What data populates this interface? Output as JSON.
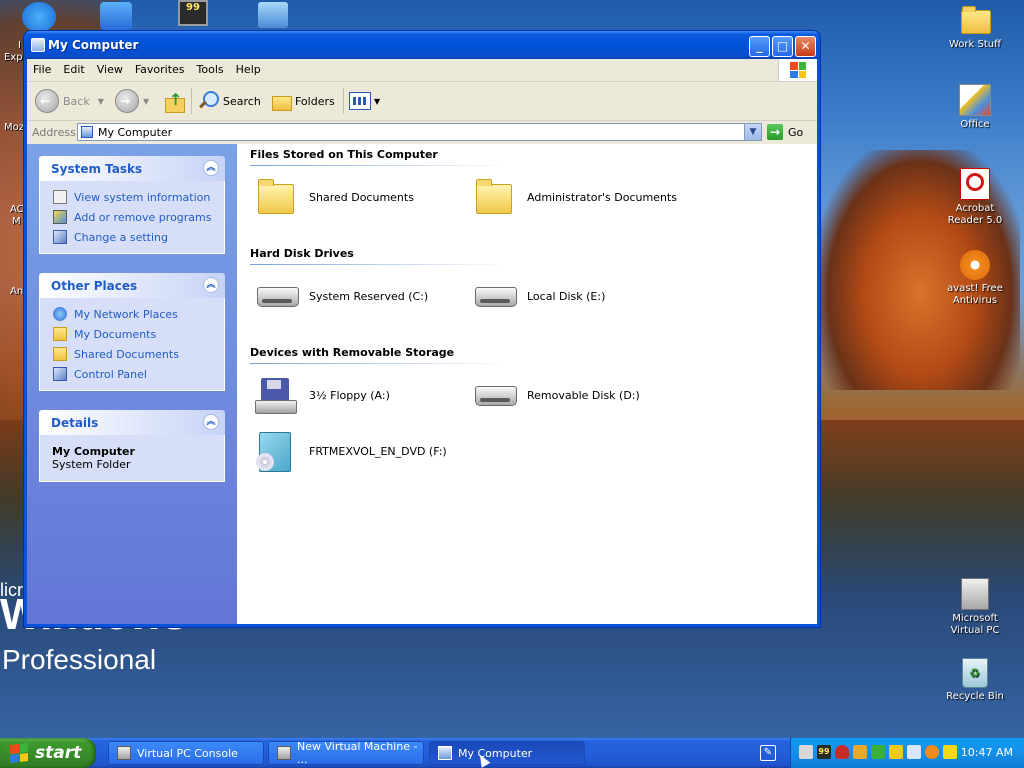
{
  "desktop": {
    "left_labels": [
      "I",
      "Exp",
      "Moz",
      "AC",
      "M",
      "An"
    ],
    "top_badge": "99",
    "icons": [
      {
        "label": "Work Stuff"
      },
      {
        "label": "Office"
      },
      {
        "label": "Acrobat Reader 5.0"
      },
      {
        "label": "avast! Free Antivirus"
      },
      {
        "label": "Microsoft Virtual PC"
      },
      {
        "label": "Recycle Bin"
      }
    ],
    "brand": {
      "line1": "licr",
      "line2": "Windows",
      "line3": "Professional"
    }
  },
  "window": {
    "title": "My Computer",
    "controls": {
      "minimize": "_",
      "maximize": "□",
      "close": "✕"
    },
    "menu": [
      "File",
      "Edit",
      "View",
      "Favorites",
      "Tools",
      "Help"
    ],
    "toolbar": {
      "back": "Back",
      "search": "Search",
      "folders": "Folders"
    },
    "address": {
      "label": "Address",
      "value": "My Computer",
      "go": "Go"
    },
    "left_pane": {
      "system_tasks": {
        "title": "System Tasks",
        "items": [
          "View system information",
          "Add or remove programs",
          "Change a setting"
        ]
      },
      "other_places": {
        "title": "Other Places",
        "items": [
          "My Network Places",
          "My Documents",
          "Shared Documents",
          "Control Panel"
        ]
      },
      "details": {
        "title": "Details",
        "name": "My Computer",
        "type": "System Folder"
      }
    },
    "groups": {
      "files": {
        "title": "Files Stored on This Computer",
        "items": [
          "Shared Documents",
          "Administrator's Documents"
        ]
      },
      "hdd": {
        "title": "Hard Disk Drives",
        "items": [
          "System Reserved (C:)",
          "Local Disk (E:)"
        ]
      },
      "removable": {
        "title": "Devices with Removable Storage",
        "items": [
          "3½ Floppy (A:)",
          "Removable Disk (D:)",
          "FRTMEXVOL_EN_DVD (F:)"
        ]
      }
    }
  },
  "taskbar": {
    "start": "start",
    "tasks": [
      "Virtual PC Console",
      "New Virtual Machine - ...",
      "My Computer"
    ],
    "tray_badge": "99",
    "clock": "10:47 AM"
  },
  "colors": {
    "accent": "#0a52d8",
    "start_green": "#3c9a2c",
    "link_blue": "#215dc6"
  }
}
